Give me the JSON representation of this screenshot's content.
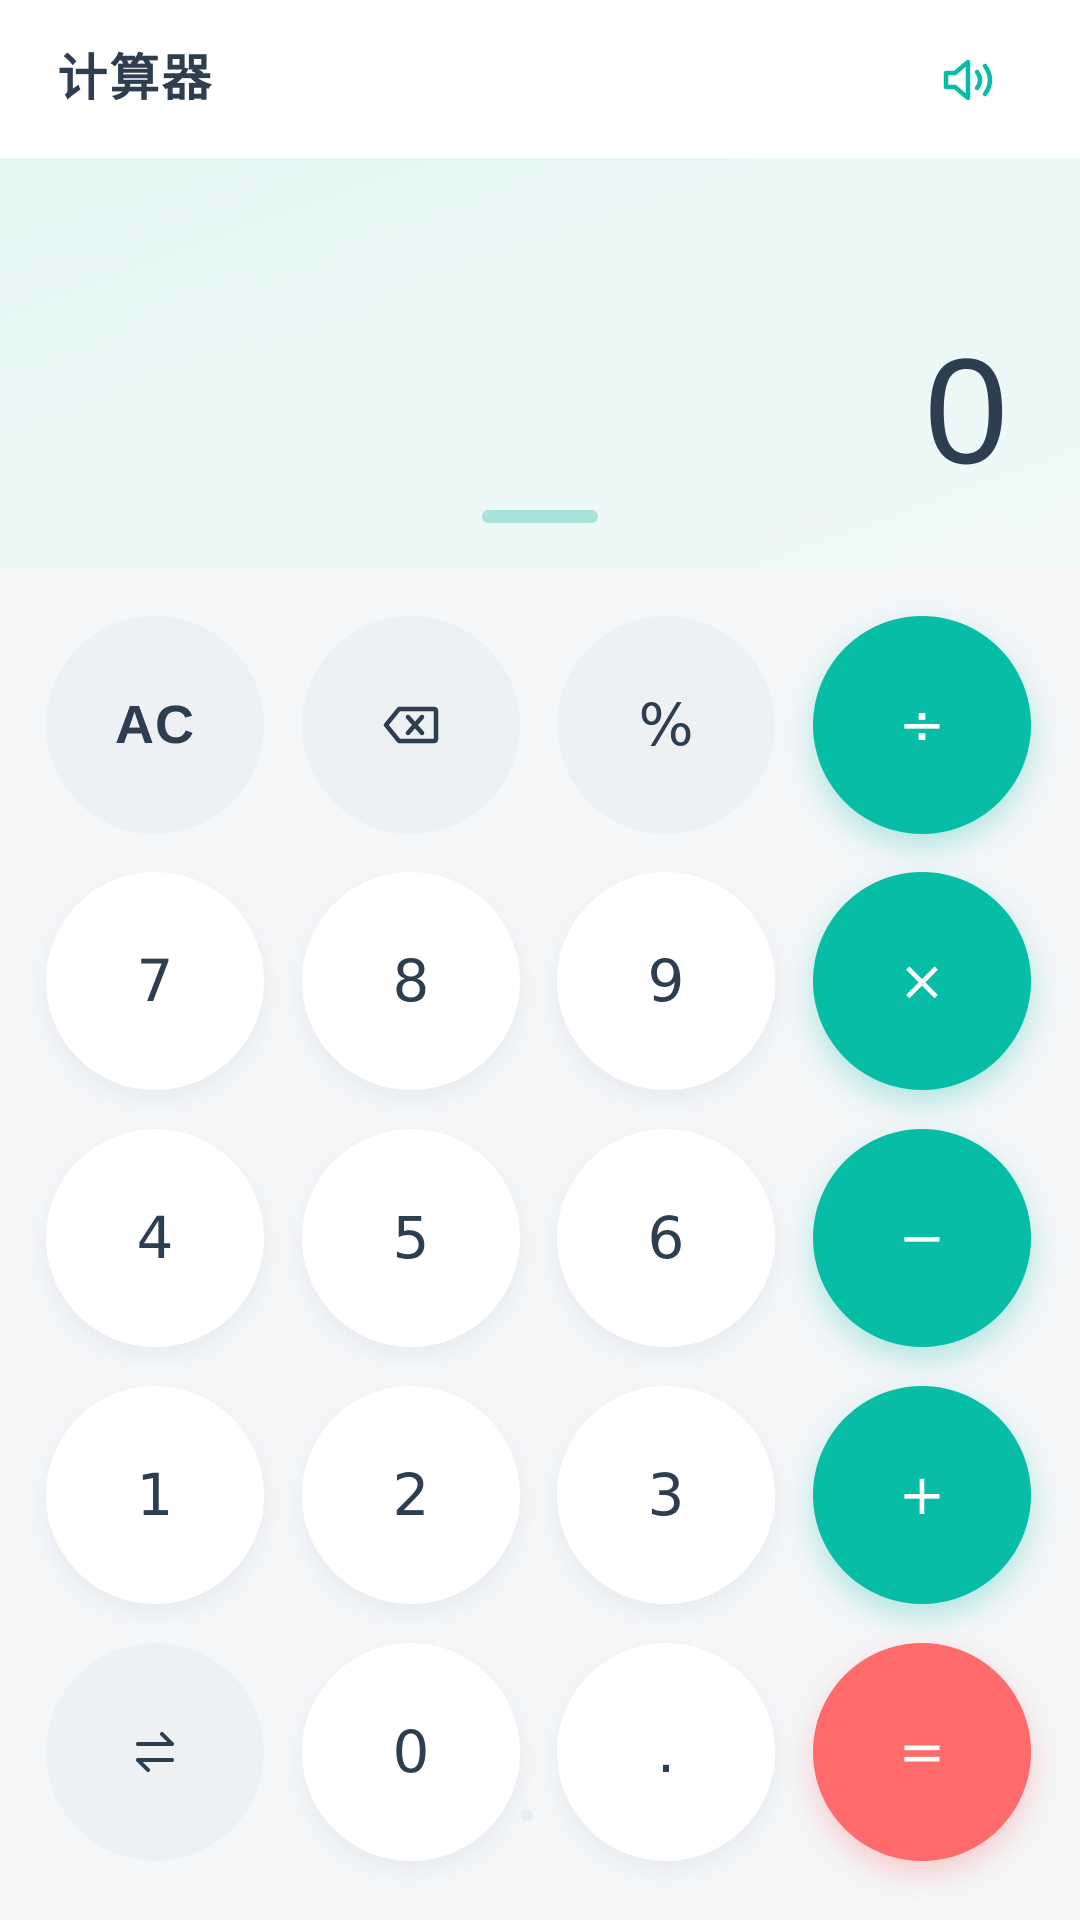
{
  "header": {
    "title": "计算器",
    "sound_icon": "speaker-volume-icon"
  },
  "display": {
    "value": "0"
  },
  "colors": {
    "accent": "#08bda6",
    "equals": "#ff6b6b",
    "text": "#2c3e50",
    "function_key_bg": "#edf1f4",
    "number_key_bg": "#ffffff"
  },
  "keys": {
    "clear": "AC",
    "backspace_icon": "backspace-icon",
    "percent": "%",
    "divide": "÷",
    "seven": "7",
    "eight": "8",
    "nine": "9",
    "multiply": "×",
    "four": "4",
    "five": "5",
    "six": "6",
    "subtract": "−",
    "one": "1",
    "two": "2",
    "three": "3",
    "add": "+",
    "swap_icon": "swap-arrows-icon",
    "zero": "0",
    "decimal": ".",
    "equals": "="
  }
}
